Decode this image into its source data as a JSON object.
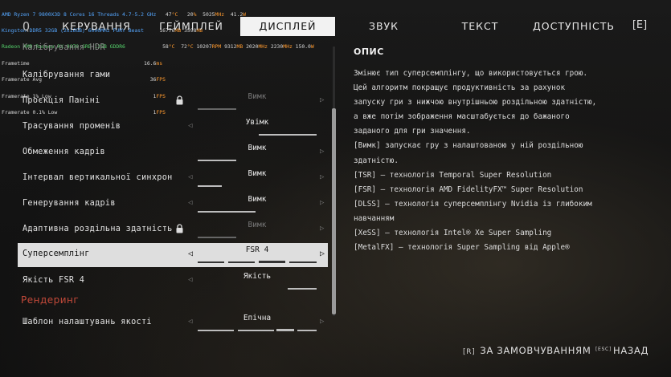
{
  "perf_overlay": [
    {
      "label": "AMD Ryzen 7 9800X3D 8 Cores 16 Threads 4.7-5.2 GHz",
      "vals": [
        "47",
        "20",
        "5025",
        "41.2"
      ],
      "units": [
        "°C",
        "%",
        "MHz",
        "W"
      ]
    },
    {
      "label": "Kingston DDR5 32GB (2x16GB) 6000MHz FURY Beast",
      "vals": [
        "16776",
        "3598"
      ],
      "units": [
        "MB",
        "MB"
      ]
    },
    {
      "label": "Radeon AMD Radeon RX 9070 GRE 12GB GDDR6",
      "vals": [
        "58",
        "72",
        "10207",
        "9312",
        "2020",
        "2230",
        "150.0"
      ],
      "units": [
        "°C",
        "°C",
        "RPM",
        "MB",
        "MHz",
        "MHz",
        "W"
      ]
    },
    {
      "label": "Frametime",
      "vals": [
        "16.6"
      ],
      "units": [
        "ms"
      ]
    },
    {
      "label": "Framerate Avg",
      "vals": [
        "36"
      ],
      "units": [
        "FPS"
      ]
    },
    {
      "label": "Framerate 1% Low",
      "vals": [
        "1"
      ],
      "units": [
        "FPS"
      ]
    },
    {
      "label": "Framerate 0.1% Low",
      "vals": [
        "1"
      ],
      "units": [
        "FPS"
      ]
    }
  ],
  "nav": {
    "tabs": [
      {
        "label": "КЕРУВАННЯ",
        "active": false
      },
      {
        "label": "ГЕЙМПЛЕЙ",
        "active": false
      },
      {
        "label": "ДИСПЛЕЙ",
        "active": true
      },
      {
        "label": "ЗВУК",
        "active": false
      },
      {
        "label": "ТЕКСТ",
        "active": false
      },
      {
        "label": "ДОСТУПНІСТЬ",
        "active": false
      }
    ],
    "prev_key": "Q",
    "next_key": "[E]"
  },
  "settings": {
    "partial_row": "Калібрування HDR",
    "calibrate_gamma": "Калібрування гами",
    "rows": [
      {
        "label": "Проєкція Паніні",
        "value": "Вимк",
        "locked": true
      },
      {
        "label": "Трасування променів",
        "value": "Увімк",
        "locked": false
      },
      {
        "label": "Обмеження кадрів",
        "value": "Вимк",
        "locked": false
      },
      {
        "label": "Інтервал вертикальної синхрон",
        "value": "Вимк",
        "locked": false
      },
      {
        "label": "Генерування кадрів",
        "value": "Вимк",
        "locked": false
      },
      {
        "label": "Адаптивна роздільна здатність",
        "value": "Вимк",
        "locked": true
      },
      {
        "label": "Суперсемплінг",
        "value": "FSR 4",
        "locked": false,
        "selected": true
      },
      {
        "label": "Якість FSR 4",
        "value": "Якість",
        "locked": false
      }
    ],
    "section_rendering": "Рендеринг",
    "quality_preset": {
      "label": "Шаблон налаштувань якості",
      "value": "Епічна"
    }
  },
  "description": {
    "title": "ОПИС",
    "lines": [
      "Змінює тип суперсемплінгу, що використовується грою.",
      "Цей алгоритм покращує продуктивність за рахунок",
      "запуску гри з нижчою внутрішньою роздільною здатністю,",
      "а вже потім зображення масштабується до бажаного",
      "заданого для гри значення.",
      "[Вимк] запускає гру з налаштованою у ній роздільною",
      "здатністю.",
      "[TSR] — технологія Temporal Super Resolution",
      "[FSR] — технологія AMD FidelityFX™ Super Resolution",
      "[DLSS] — технологія суперсемплінгу Nvidia із глибоким",
      "навчанням",
      "[XeSS] — технологія Intel® Xe Super Sampling",
      "[MetalFX] — технологія Super Sampling від Apple®"
    ]
  },
  "bottom": {
    "reset_key": "[R]",
    "reset_label": "ЗА ЗАМОВЧУВАННЯМ",
    "back_key": "ESC",
    "back_label": "НАЗАД"
  },
  "colors": {
    "section": "#c44a3a",
    "active_tab": "#f2f2f2",
    "perf_blue": "#55a7ff",
    "perf_orange": "#ff9a2e",
    "perf_green": "#55d16b"
  }
}
